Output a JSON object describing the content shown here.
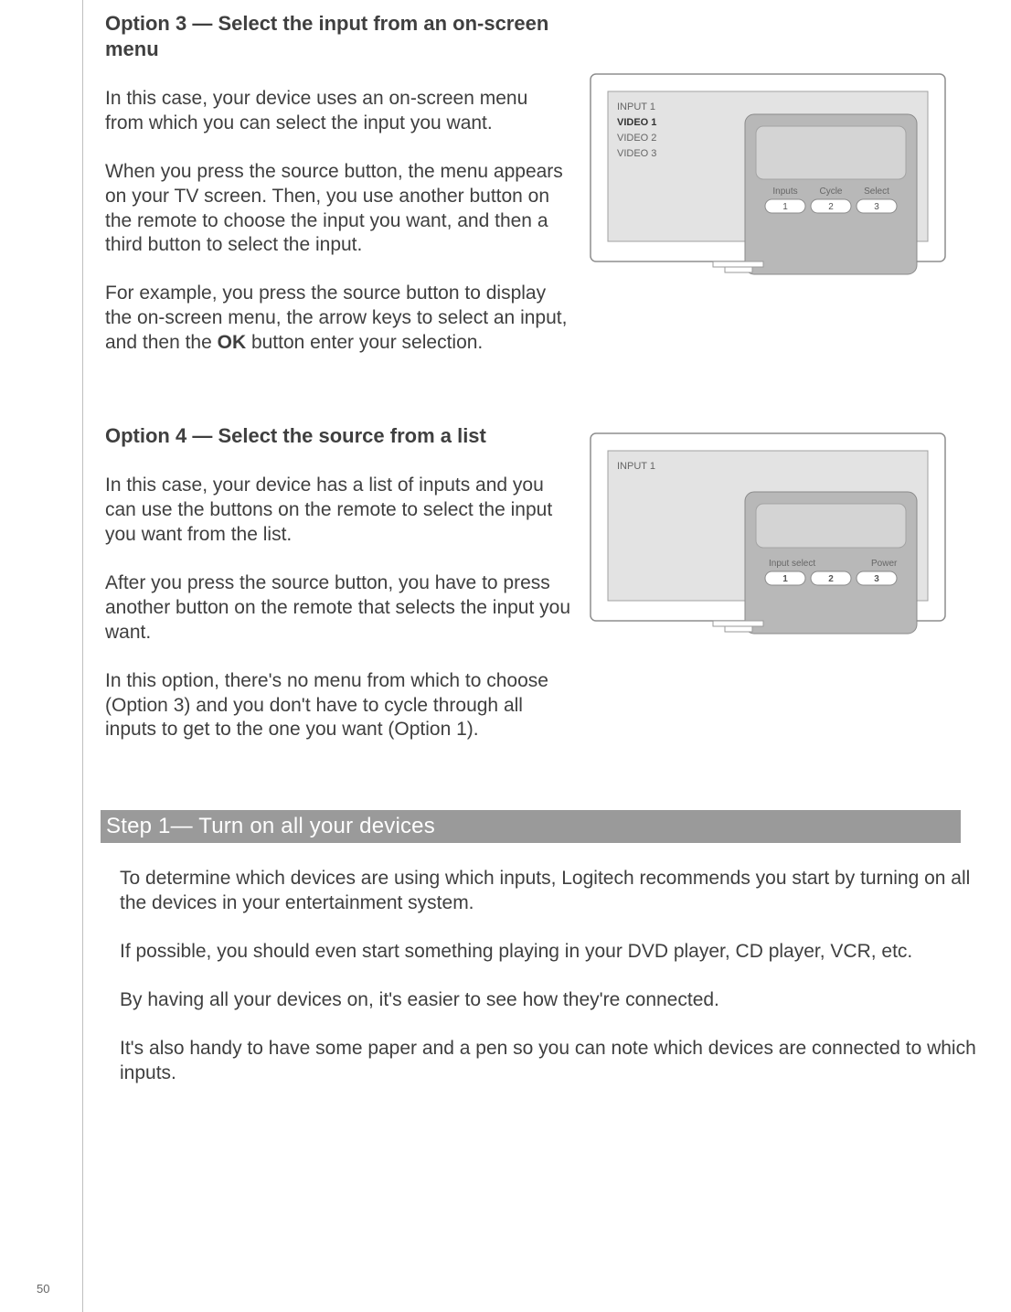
{
  "option3": {
    "heading": "Option 3 — Select the input from an on-screen menu",
    "p1": "In this case, your device uses an on-screen menu from which you can select the input you want.",
    "p2": "When you press the source button, the menu appears on your TV screen. Then, you use another button on the remote to choose the input you want, and then a third button to select the input.",
    "p3a": "For example, you press the source button to display the on-screen menu, the arrow keys to select an input, and then the ",
    "p3_ok": "OK",
    "p3b": " button enter your selection."
  },
  "option4": {
    "heading": "Option 4 — Select the source from a list",
    "p1": "In this case, your device has a list of inputs and you can use the buttons on the remote to select the input you want from the list.",
    "p2": "After you press the source button, you have to press another button on the remote that selects the input you want.",
    "p3": "In this option, there's no menu from which to choose (Option 3) and you don't have to cycle through all inputs to get to the one you want (Option 1)."
  },
  "step1": {
    "bar": "Step 1— Turn on all your devices",
    "p1": "To determine which devices are using which inputs, Logitech recommends you start by turning on all the devices in your entertainment system.",
    "p2": "If possible, you should even start something playing in your DVD player, CD player, VCR, etc.",
    "p3": "By having all your devices on, it's easier to see how they're connected.",
    "p4": "It's also handy to have some paper and a pen so you can note which devices are connected to which inputs."
  },
  "illus3": {
    "menu": [
      "INPUT 1",
      "VIDEO 1",
      "VIDEO 2",
      "VIDEO 3"
    ],
    "selected_index": 1,
    "labels": [
      "Inputs",
      "Cycle",
      "Select"
    ],
    "nums": [
      "1",
      "2",
      "3"
    ]
  },
  "illus4": {
    "header": "INPUT 1",
    "labels": [
      "Input select",
      "Power"
    ],
    "nums": [
      "1",
      "2",
      "3"
    ]
  },
  "page_number": "50"
}
